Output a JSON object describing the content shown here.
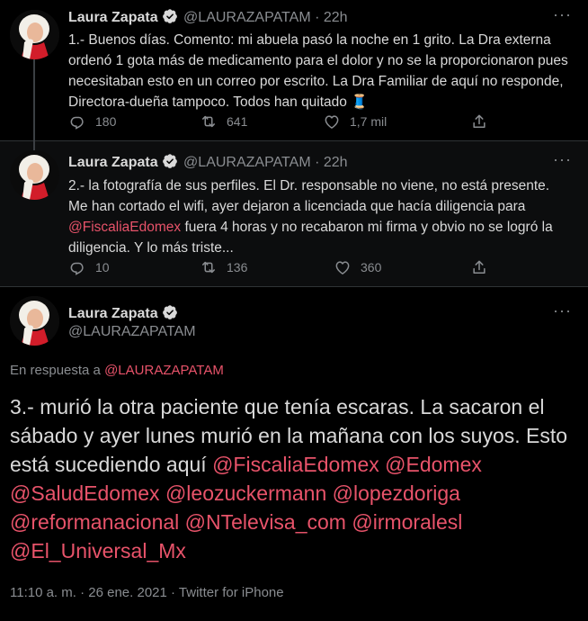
{
  "tweet1": {
    "name": "Laura Zapata",
    "handle": "@LAURAZAPATAM",
    "dot": "·",
    "time": "22h",
    "more": "···",
    "text": "1.- Buenos días. Comento: mi abuela pasó la noche en 1 grito. La Dra externa ordenó 1 gota más de medicamento para el dolor y no se la proporcionaron pues necesitaban esto en un correo por escrito. La Dra Familiar de aquí no responde, Directora-dueña tampoco. Todos han quitado",
    "emoji": "🧵",
    "replies": "180",
    "retweets": "641",
    "likes": "1,7 mil"
  },
  "tweet2": {
    "name": "Laura Zapata",
    "handle": "@LAURAZAPATAM",
    "dot": "·",
    "time": "22h",
    "more": "···",
    "text_a": "2.- la fotografía de sus perfiles. El Dr. responsable no viene, no está presente. Me han cortado el wifi, ayer dejaron a licenciada que hacía diligencia para ",
    "mention": "@FiscaliaEdomex",
    "text_b": " fuera 4 horas y no recabaron mi firma y obvio no se logró la diligencia. Y lo más triste...",
    "replies": "10",
    "retweets": "136",
    "likes": "360"
  },
  "tweet3": {
    "name": "Laura Zapata",
    "handle": "@LAURAZAPATAM",
    "more": "···",
    "reply_prefix": "En respuesta a ",
    "reply_mention": "@LAURAZAPATAM",
    "text": "3.- murió la otra paciente que tenía escaras. La sacaron el sábado y ayer lunes murió en la mañana con los suyos. Esto está sucediendo aquí ",
    "mentions": [
      "@FiscaliaEdomex",
      "@Edomex",
      "@SaludEdomex",
      "@leozuckermann",
      "@lopezdoriga",
      "@reformanacional",
      "@NTelevisa_com",
      "@irmoralesl",
      "@El_Universal_Mx"
    ],
    "meta": "11:10 a. m. · 26 ene. 2021 · Twitter for iPhone"
  },
  "colors": {
    "background": "#000000",
    "mention": "#e8536a",
    "secondary_text": "#8a8d91",
    "verified": "#d9d9d9"
  },
  "icons": [
    "reply-icon",
    "retweet-icon",
    "like-icon",
    "share-icon",
    "verified-icon",
    "more-icon"
  ]
}
